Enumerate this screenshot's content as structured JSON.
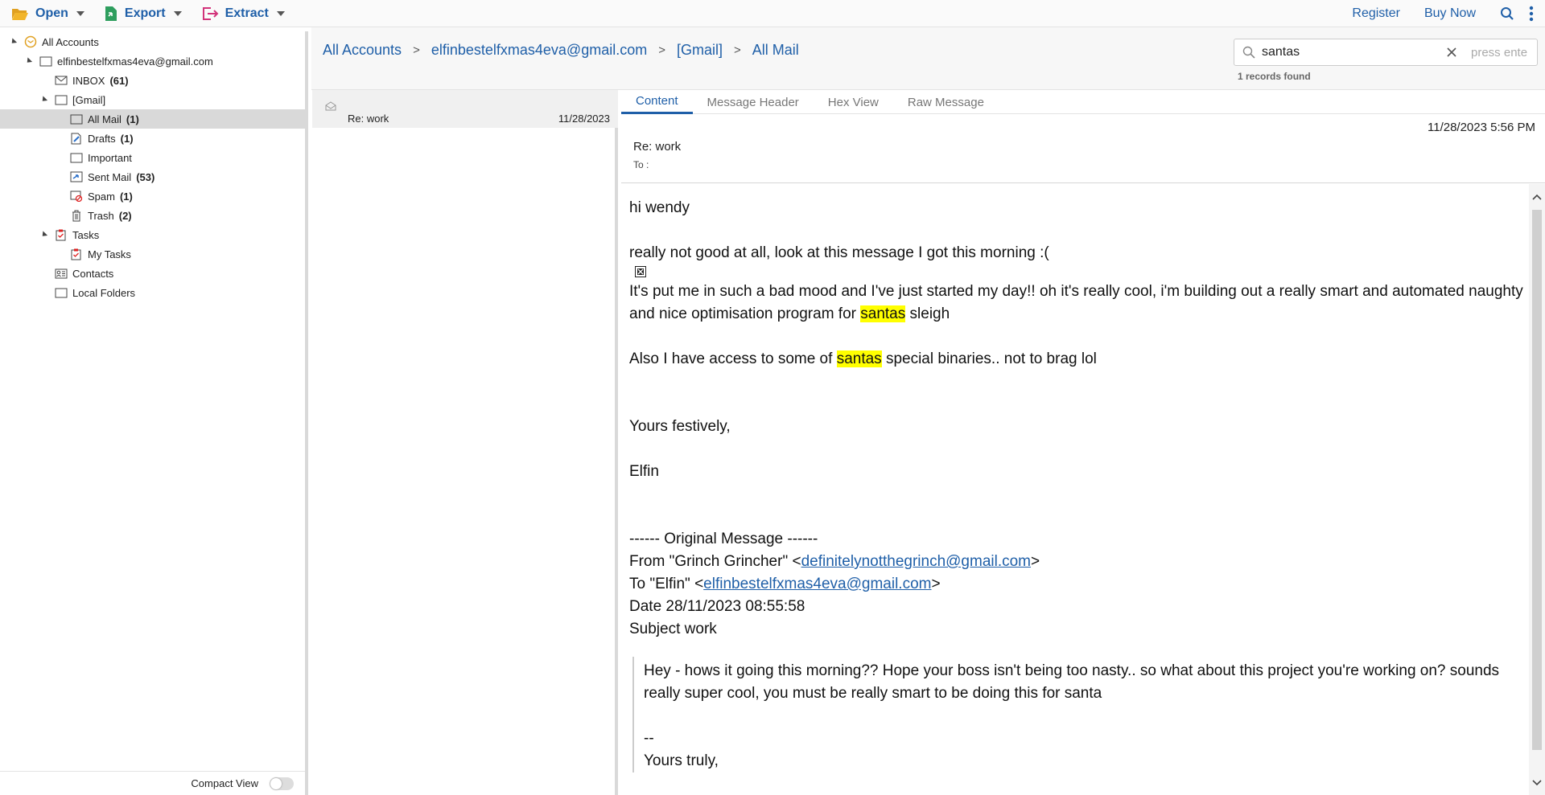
{
  "toolbar": {
    "open_label": "Open",
    "export_label": "Export",
    "extract_label": "Extract",
    "register_label": "Register",
    "buy_now_label": "Buy Now",
    "icons": [
      "folder-open-icon",
      "export-doc-icon",
      "extract-icon",
      "search-icon",
      "more-vertical-icon"
    ]
  },
  "sidebar": {
    "items": [
      {
        "label": "All Accounts",
        "count": ""
      },
      {
        "label": "elfinbestelfxmas4eva@gmail.com",
        "count": ""
      },
      {
        "label": "INBOX",
        "count": "(61)"
      },
      {
        "label": "[Gmail]",
        "count": ""
      },
      {
        "label": "All Mail",
        "count": "(1)"
      },
      {
        "label": "Drafts",
        "count": "(1)"
      },
      {
        "label": "Important",
        "count": ""
      },
      {
        "label": "Sent Mail",
        "count": "(53)"
      },
      {
        "label": "Spam",
        "count": "(1)"
      },
      {
        "label": "Trash",
        "count": "(2)"
      },
      {
        "label": "Tasks",
        "count": ""
      },
      {
        "label": "My Tasks",
        "count": ""
      },
      {
        "label": "Contacts",
        "count": ""
      },
      {
        "label": "Local Folders",
        "count": ""
      }
    ],
    "compact_view_label": "Compact View"
  },
  "breadcrumb": {
    "items": [
      "All Accounts",
      "elfinbestelfxmas4eva@gmail.com",
      "[Gmail]",
      "All Mail"
    ]
  },
  "search": {
    "value": "santas",
    "hint": "press ente",
    "records_found": "1 records found"
  },
  "message_list": {
    "items": [
      {
        "subject": "Re: work",
        "date": "11/28/2023"
      }
    ]
  },
  "tabs": [
    "Content",
    "Message Header",
    "Hex View",
    "Raw Message"
  ],
  "message": {
    "datetime": "11/28/2023 5:56 PM",
    "subject": "Re: work",
    "to_label": "To :",
    "greeting": "hi wendy",
    "line1": "really not good at all, look at this message I got this morning :(",
    "para2_a": "It's put me in such a bad mood and I've just started my day!! oh it's really cool, i'm building out a really smart and automated naughty and nice optimisation program for ",
    "highlight": "santas",
    "para2_b": " sleigh",
    "para3_a": "Also I have access to some of ",
    "para3_b": " special binaries.. not to brag lol",
    "closing": "Yours festively,",
    "signature": "Elfin",
    "orig_header": "------ Original Message ------",
    "from_prefix": "From \"Grinch Grincher\" <",
    "from_email": "definitelynotthegrinch@gmail.com",
    "from_suffix": ">",
    "to_prefix": "To \"Elfin\" <",
    "to_email": "elfinbestelfxmas4eva@gmail.com",
    "to_suffix": ">",
    "date_line": "Date 28/11/2023 08:55:58",
    "subject_line": "Subject work",
    "quote_text": "Hey - hows it going this morning?? Hope your boss isn't being too nasty.. so what about this project you're working on? sounds really super cool, you must be really smart to be doing this for santa",
    "quote_dash": "--",
    "quote_closing": "Yours truly,"
  },
  "colors": {
    "accent": "#1f5fa8",
    "highlight": "#ffff00",
    "selected_row": "#d9d9d9"
  }
}
